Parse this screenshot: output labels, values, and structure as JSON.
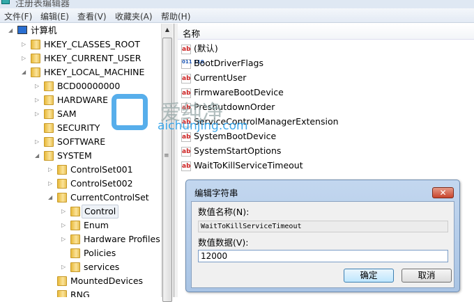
{
  "window": {
    "title": "注册表编辑器"
  },
  "menu": [
    "文件(F)",
    "编辑(E)",
    "查看(V)",
    "收藏夹(A)",
    "帮助(H)"
  ],
  "tree": [
    {
      "label": "计算机",
      "level": 0,
      "exp": "open"
    },
    {
      "label": "HKEY_CLASSES_ROOT",
      "level": 1,
      "exp": "closed"
    },
    {
      "label": "HKEY_CURRENT_USER",
      "level": 1,
      "exp": "closed"
    },
    {
      "label": "HKEY_LOCAL_MACHINE",
      "level": 1,
      "exp": "open"
    },
    {
      "label": "BCD00000000",
      "level": 2,
      "exp": "closed"
    },
    {
      "label": "HARDWARE",
      "level": 2,
      "exp": "closed"
    },
    {
      "label": "SAM",
      "level": 2,
      "exp": "closed"
    },
    {
      "label": "SECURITY",
      "level": 2,
      "exp": "none"
    },
    {
      "label": "SOFTWARE",
      "level": 2,
      "exp": "closed"
    },
    {
      "label": "SYSTEM",
      "level": 2,
      "exp": "open"
    },
    {
      "label": "ControlSet001",
      "level": 3,
      "exp": "closed"
    },
    {
      "label": "ControlSet002",
      "level": 3,
      "exp": "closed"
    },
    {
      "label": "CurrentControlSet",
      "level": 3,
      "exp": "open"
    },
    {
      "label": "Control",
      "level": 4,
      "exp": "closed",
      "selected": true
    },
    {
      "label": "Enum",
      "level": 4,
      "exp": "closed"
    },
    {
      "label": "Hardware Profiles",
      "level": 4,
      "exp": "closed"
    },
    {
      "label": "Policies",
      "level": 4,
      "exp": "none"
    },
    {
      "label": "services",
      "level": 4,
      "exp": "closed"
    },
    {
      "label": "MountedDevices",
      "level": 3,
      "exp": "none"
    },
    {
      "label": "RNG",
      "level": 3,
      "exp": "none"
    }
  ],
  "list": {
    "header": "名称",
    "items": [
      {
        "name": "(默认)",
        "type": "string"
      },
      {
        "name": "BootDriverFlags",
        "type": "binary"
      },
      {
        "name": "CurrentUser",
        "type": "string"
      },
      {
        "name": "FirmwareBootDevice",
        "type": "string"
      },
      {
        "name": "PreshutdownOrder",
        "type": "string"
      },
      {
        "name": "ServiceControlManagerExtension",
        "type": "string"
      },
      {
        "name": "SystemBootDevice",
        "type": "string"
      },
      {
        "name": "SystemStartOptions",
        "type": "string"
      },
      {
        "name": "WaitToKillServiceTimeout",
        "type": "string"
      }
    ]
  },
  "icons": {
    "string": "ab",
    "binary": "011 110"
  },
  "watermark": {
    "zh": "爱纯净",
    "en": "aichunjing.com"
  },
  "dialog": {
    "title": "编辑字符串",
    "close": "✕",
    "name_label": "数值名称(N):",
    "name_value": "WaitToKillServiceTimeout",
    "data_label": "数值数据(V):",
    "data_value": "12000",
    "ok": "确定",
    "cancel": "取消"
  }
}
